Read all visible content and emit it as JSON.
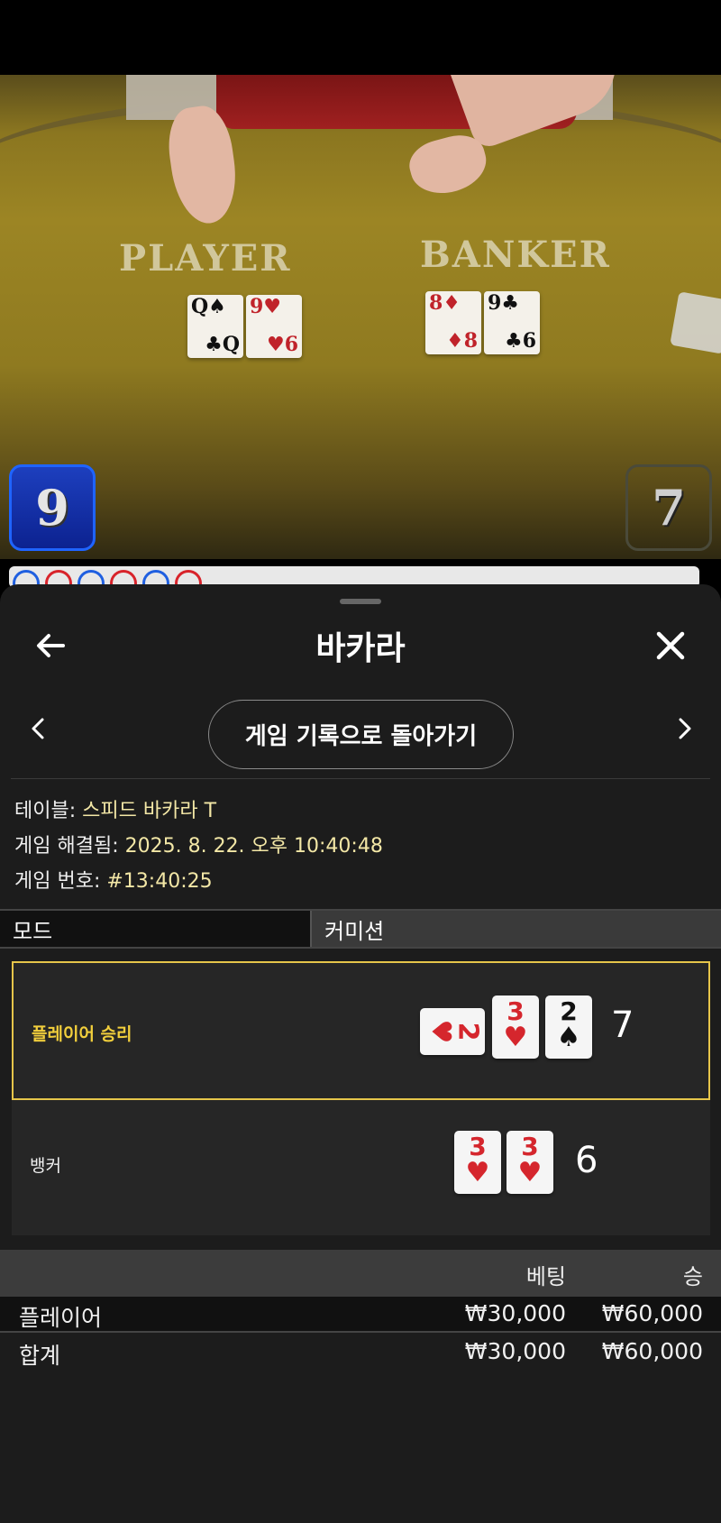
{
  "video": {
    "zone_player": "PLAYER",
    "zone_banker": "BANKER",
    "player_cards": [
      {
        "r1": "Q♠",
        "r2": "♣Q",
        "color": "black"
      },
      {
        "r1": "9♥",
        "r2": "♥6",
        "color": "red"
      }
    ],
    "banker_cards": [
      {
        "r1": "8♦",
        "r2": "♦8",
        "color": "red"
      },
      {
        "r1": "9♣",
        "r2": "♣6",
        "color": "black"
      }
    ],
    "player_score": "9",
    "banker_score": "7",
    "roadmap_colors": [
      "#1f5fe0",
      "#d8232a",
      "#1f5fe0",
      "#d8232a",
      "#1f5fe0",
      "#d8232a"
    ]
  },
  "sheet": {
    "title": "바카라",
    "history_button": "게임 기록으로 돌아가기",
    "info": {
      "table_label": "테이블:",
      "table_value": "스피드 바카라 T",
      "resolved_label": "게임 해결됨:",
      "resolved_value": "2025. 8. 22. 오후 10:40:48",
      "game_no_label": "게임 번호:",
      "game_no_value": "#13:40:25"
    },
    "mode": {
      "mode_label": "모드",
      "mode_value": "커미션"
    },
    "results": {
      "player": {
        "label": "플레이어 승리",
        "cards": [
          {
            "rank": "2",
            "suit": "♥",
            "color": "red",
            "sideways": true
          },
          {
            "rank": "3",
            "suit": "♥",
            "color": "red"
          },
          {
            "rank": "2",
            "suit": "♠",
            "color": "black"
          }
        ],
        "total": "7"
      },
      "banker": {
        "label": "뱅커",
        "cards": [
          {
            "rank": "3",
            "suit": "♥",
            "color": "red"
          },
          {
            "rank": "3",
            "suit": "♥",
            "color": "red"
          }
        ],
        "total": "6"
      }
    },
    "bets": {
      "header_bet": "베팅",
      "header_win": "승",
      "rows": [
        {
          "name": "플레이어",
          "bet": "₩30,000",
          "win": "₩60,000"
        },
        {
          "name": "합계",
          "bet": "₩30,000",
          "win": "₩60,000"
        }
      ]
    }
  },
  "icons": {
    "back": "arrow-left-icon",
    "close": "close-icon",
    "prev": "chevron-left-icon",
    "next": "chevron-right-icon"
  },
  "colors": {
    "accent_yellow": "#e6c54a",
    "player_blue": "#1d3fbe"
  }
}
